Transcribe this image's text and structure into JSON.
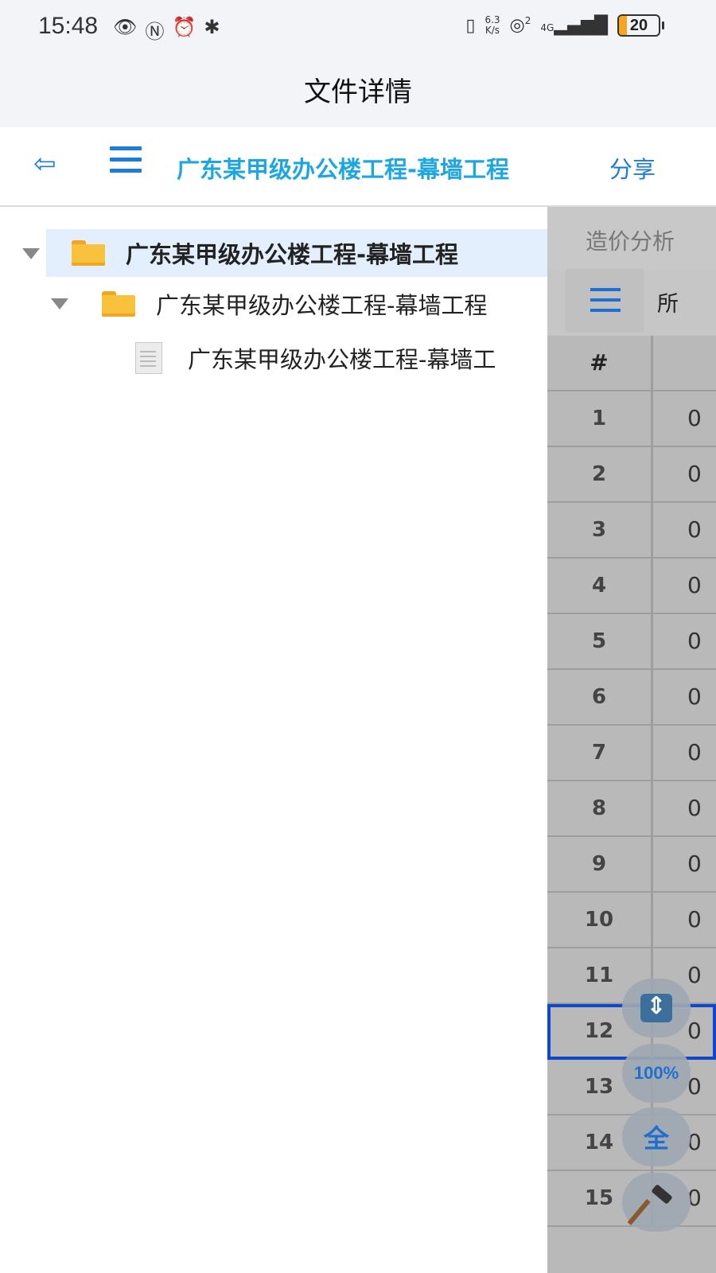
{
  "status_bar": {
    "time": "15:48",
    "left_icons": [
      "eye-icon",
      "nfc-icon",
      "alarm-icon",
      "bluetooth-battery-icon"
    ],
    "speed_top": "6.3",
    "speed_bottom": "K/s",
    "hotspot_sub": "2",
    "network_type": "4G",
    "battery_level": "20",
    "battery_fill_percent": 20
  },
  "header": {
    "title": "文件详情"
  },
  "toolbar": {
    "back_icon": "back-arrow-icon",
    "menu_icon": "hamburger-menu-icon",
    "project_title": "广东某甲级办公楼工程-幕墙工程",
    "share_label": "分享"
  },
  "tree": {
    "items": [
      {
        "label": "广东某甲级办公楼工程-幕墙工程",
        "type": "folder",
        "level": 0,
        "selected": true
      },
      {
        "label": "广东某甲级办公楼工程-幕墙工程",
        "type": "folder",
        "level": 1,
        "selected": false
      },
      {
        "label": "广东某甲级办公楼工程-幕墙工",
        "type": "file",
        "level": 2,
        "selected": false
      }
    ]
  },
  "side_panel": {
    "tab_label": "造价分析",
    "toolbar_label": "所",
    "table": {
      "header": "#",
      "rows": [
        {
          "num": "1",
          "val": "0"
        },
        {
          "num": "2",
          "val": "0"
        },
        {
          "num": "3",
          "val": "0"
        },
        {
          "num": "4",
          "val": "0"
        },
        {
          "num": "5",
          "val": "0"
        },
        {
          "num": "6",
          "val": "0"
        },
        {
          "num": "7",
          "val": "0"
        },
        {
          "num": "8",
          "val": "0"
        },
        {
          "num": "9",
          "val": "0"
        },
        {
          "num": "10",
          "val": "0"
        },
        {
          "num": "11",
          "val": "0"
        },
        {
          "num": "12",
          "val": "0"
        },
        {
          "num": "13",
          "val": "0"
        },
        {
          "num": "14",
          "val": "0"
        },
        {
          "num": "15",
          "val": "0"
        }
      ],
      "selected_row": "12"
    }
  },
  "floating_buttons": {
    "resize_icon": "up-down-arrows-icon",
    "zoom_label": "100%",
    "full_label": "全",
    "tool_icon": "hammer-icon"
  },
  "colors": {
    "accent_blue": "#1e7bd8",
    "title_cyan": "#1da6e0",
    "selected_row_bg": "#e3effc",
    "panel_gray": "#b9b9b9",
    "selection_outline": "#1148c9"
  }
}
